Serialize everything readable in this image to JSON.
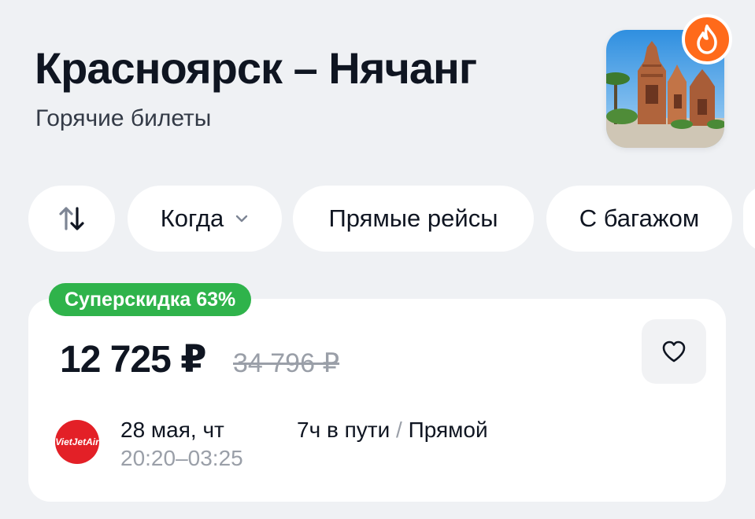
{
  "header": {
    "title": "Красноярск – Нячанг",
    "subtitle": "Горячие билеты",
    "thumbnail_icon": "temple-photo",
    "hot_icon": "fire-icon"
  },
  "filters": {
    "swap_icon": "swap-arrows-icon",
    "when_label": "Когда",
    "direct_label": "Прямые рейсы",
    "baggage_label": "С багажом"
  },
  "ticket": {
    "badge": "Суперскидка 63%",
    "price": "12 725 ₽",
    "old_price": "34 796 ₽",
    "favorite_icon": "heart-icon",
    "airline_logo": "VietJetAir",
    "date": "28 мая, чт",
    "depart": "20:20",
    "dash": "–",
    "arrive": "03:25",
    "duration": "7ч в пути",
    "slash": "/",
    "type": "Прямой"
  },
  "colors": {
    "background": "#eff1f4",
    "badge_green": "#2fb34b",
    "fire_orange": "#ff6a1a",
    "airline_red": "#e32027",
    "muted_text": "#9a9fa8"
  }
}
